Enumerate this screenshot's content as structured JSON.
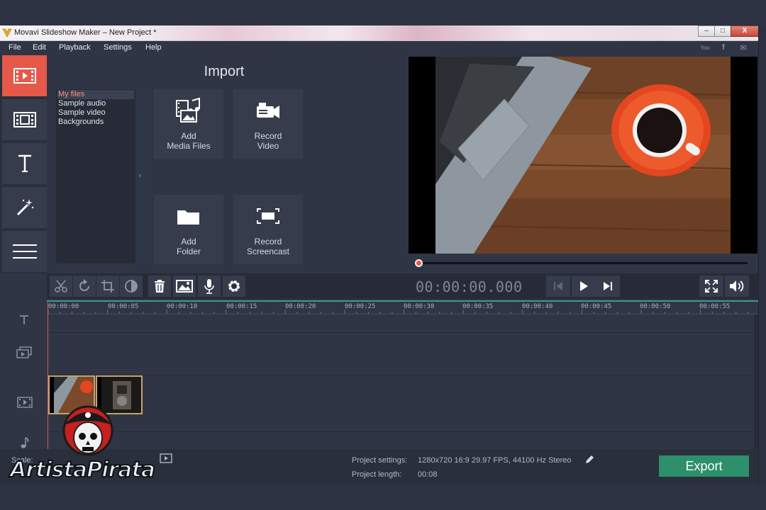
{
  "window": {
    "title": "Movavi Slideshow Maker – New Project *",
    "min": "‒",
    "max": "□",
    "close": "X"
  },
  "menu": {
    "items": [
      "File",
      "Edit",
      "Playback",
      "Settings",
      "Help"
    ]
  },
  "social": {
    "youtube": "You",
    "facebook": "f",
    "vk": "✉"
  },
  "import": {
    "title": "Import",
    "categories": [
      "My files",
      "Sample audio",
      "Sample video",
      "Backgrounds"
    ],
    "collapse": "‹",
    "tiles": {
      "add_media": {
        "line1": "Add",
        "line2": "Media Files"
      },
      "record_video": {
        "line1": "Record",
        "line2": "Video"
      },
      "add_folder": {
        "line1": "Add",
        "line2": "Folder"
      },
      "record_screencast": {
        "line1": "Record",
        "line2": "Screencast"
      }
    }
  },
  "player": {
    "timecode": "00:00:00.000"
  },
  "timeline": {
    "ruler": [
      "00:00:00",
      "00:00:05",
      "00:00:10",
      "00:00:15",
      "00:00:20",
      "00:00:25",
      "00:00:30",
      "00:00:35",
      "00:00:40",
      "00:00:45",
      "00:00:50",
      "00:00:55"
    ]
  },
  "footer": {
    "scale_label": "Scale:",
    "settings_label": "Project settings:",
    "settings_value": "1280x720 16:9 29.97 FPS, 44100 Hz Stereo",
    "length_label": "Project length:",
    "length_value": "00:08",
    "export": "Export"
  },
  "watermark": {
    "text": "ArtistaPirata"
  },
  "colors": {
    "accent": "#e5584a",
    "export": "#2e8f6b",
    "panel": "#2f3545",
    "playhead": "#3c9c88"
  }
}
